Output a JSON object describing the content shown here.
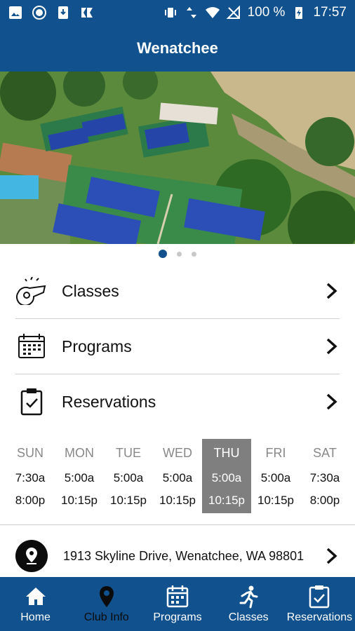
{
  "status_bar": {
    "battery": "100 %",
    "time": "17:57"
  },
  "app_bar": {
    "title": "Wenatchee"
  },
  "carousel": {
    "page_count": 3,
    "active_index": 0
  },
  "menu": [
    {
      "label": "Classes",
      "icon": "whistle-icon"
    },
    {
      "label": "Programs",
      "icon": "calendar-icon"
    },
    {
      "label": "Reservations",
      "icon": "clipboard-check-icon"
    }
  ],
  "hours": [
    {
      "day": "SUN",
      "open": "7:30a",
      "close": "8:00p"
    },
    {
      "day": "MON",
      "open": "5:00a",
      "close": "10:15p"
    },
    {
      "day": "TUE",
      "open": "5:00a",
      "close": "10:15p"
    },
    {
      "day": "WED",
      "open": "5:00a",
      "close": "10:15p"
    },
    {
      "day": "THU",
      "open": "5:00a",
      "close": "10:15p",
      "today": true
    },
    {
      "day": "FRI",
      "open": "5:00a",
      "close": "10:15p"
    },
    {
      "day": "SAT",
      "open": "7:30a",
      "close": "8:00p"
    }
  ],
  "address": {
    "text": "1913 Skyline Drive, Wenatchee, WA 98801",
    "icon": "location-pin-icon"
  },
  "bottom_nav": [
    {
      "label": "Home",
      "icon": "home-icon"
    },
    {
      "label": "Club Info",
      "icon": "location-pin-icon",
      "active": true
    },
    {
      "label": "Programs",
      "icon": "calendar-icon"
    },
    {
      "label": "Classes",
      "icon": "runner-icon"
    },
    {
      "label": "Reservations",
      "icon": "clipboard-check-icon"
    }
  ],
  "colors": {
    "primary": "#10518e",
    "today_bg": "#7f7f7f",
    "nav_active": "#0b0b0b"
  }
}
